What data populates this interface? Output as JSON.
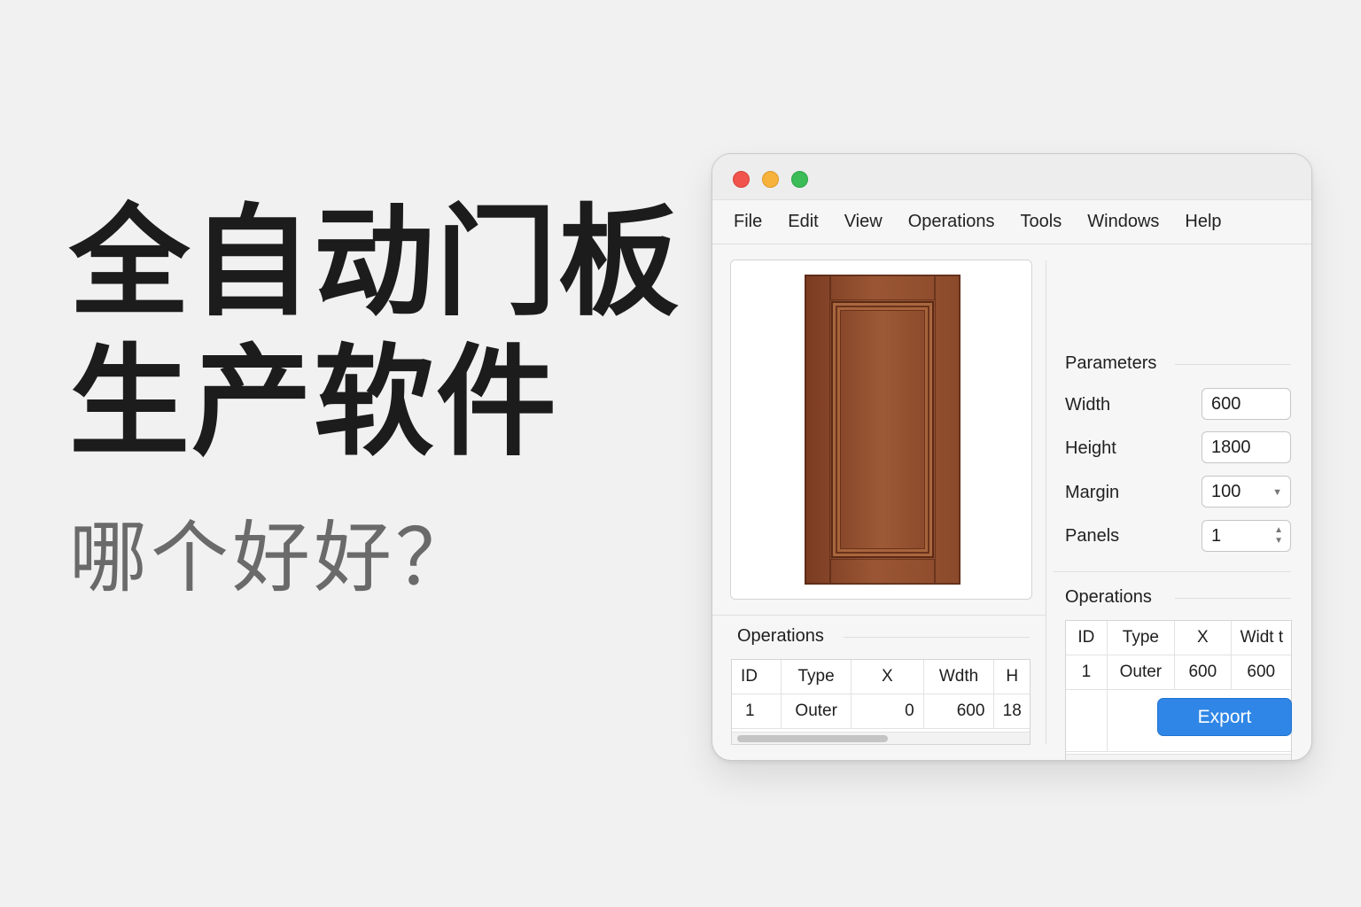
{
  "headline": {
    "line1": "全自动门板",
    "line2": "生产软件",
    "sub": "哪个好好？"
  },
  "window": {
    "menu": [
      "File",
      "Edit",
      "View",
      "Operations",
      "Tools",
      "Windows",
      "Help"
    ],
    "parameters": {
      "title": "Parameters",
      "width_label": "Width",
      "width_value": "600",
      "height_label": "Height",
      "height_value": "1800",
      "margin_label": "Margin",
      "margin_value": "100",
      "panels_label": "Panels",
      "panels_value": "1"
    },
    "ops_left": {
      "title": "Operations",
      "headers": [
        "ID",
        "Type",
        "X",
        "Wdth",
        "H"
      ],
      "rows": [
        [
          "1",
          "Outer",
          "0",
          "600",
          "18"
        ]
      ]
    },
    "ops_right": {
      "title": "Operations",
      "headers": [
        "ID",
        "Type",
        "X",
        "Widt t"
      ],
      "rows": [
        [
          "1",
          "Outer",
          "600",
          "600"
        ]
      ]
    },
    "export_label": "Export",
    "colors": {
      "accent": "#2f86e6",
      "door": "#8b4a2b"
    }
  }
}
